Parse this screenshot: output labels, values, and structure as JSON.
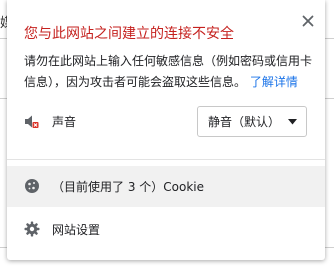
{
  "popup": {
    "title": "您与此网站之间建立的连接不安全",
    "desc_line1": "请勿在此网站上输入任何敏感信息（例如密码或信用卡",
    "desc_line2": "信息），因为攻击者可能会盗取这些信息。",
    "learn_more": "了解详情",
    "sound": {
      "label": "声音",
      "selected": "静音（默认）"
    },
    "cookie": {
      "text": "（目前使用了 3 个）Cookie"
    },
    "site_settings": {
      "label": "网站设置"
    }
  },
  "background": {
    "fragment": "媒"
  }
}
